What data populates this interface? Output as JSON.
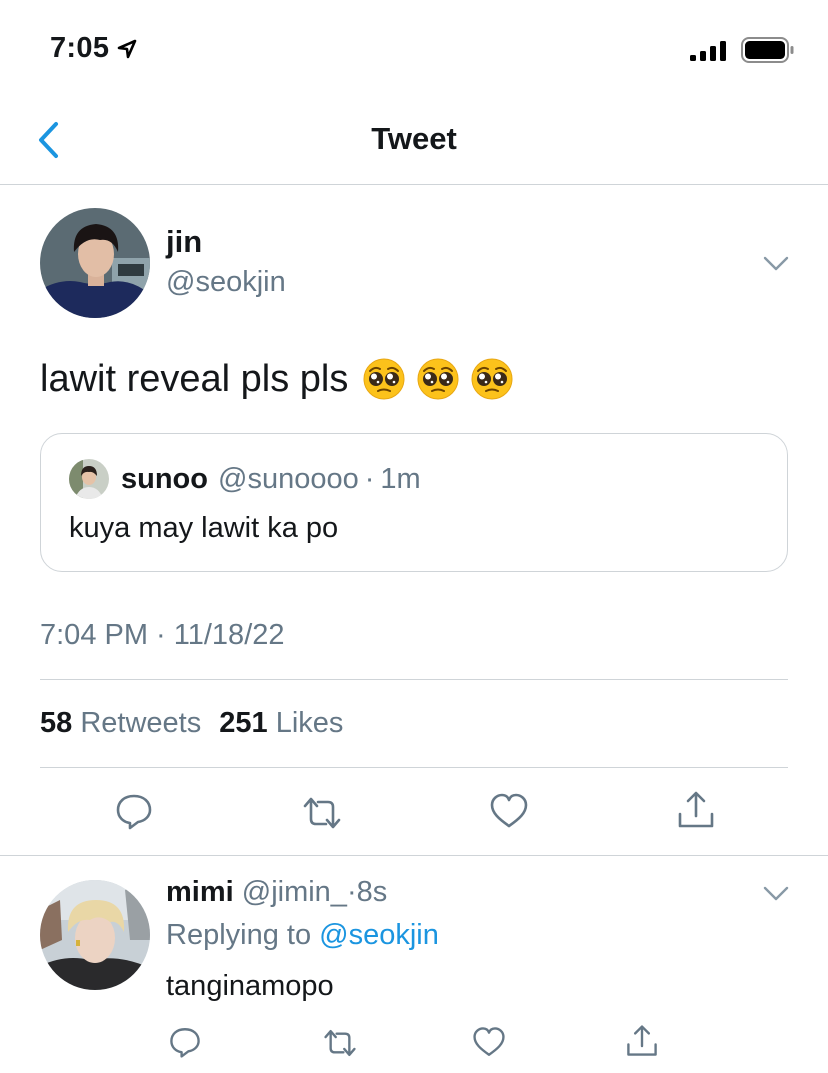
{
  "status_bar": {
    "time": "7:05"
  },
  "nav": {
    "title": "Tweet"
  },
  "tweet": {
    "author_name": "jin",
    "author_handle": "@seokjin",
    "text": "lawit reveal pls pls",
    "emojis": [
      "pleading-face",
      "pleading-face",
      "pleading-face"
    ],
    "quote": {
      "name": "sunoo",
      "handle": "@sunoooo",
      "separator": "·",
      "time": "1m",
      "text": "kuya may lawit ka po"
    },
    "timestamp": "7:04 PM · 11/18/22",
    "retweet_count": "58",
    "retweet_label": "Retweets",
    "like_count": "251",
    "like_label": "Likes",
    "actions": [
      "reply-icon",
      "retweet-icon",
      "like-icon",
      "share-icon"
    ]
  },
  "reply": {
    "name": "mimi",
    "handle": "@jimin_",
    "separator": "·",
    "time": "8s",
    "replying_prefix": "Replying to",
    "replying_to": "@seokjin",
    "text": "tanginamopo"
  },
  "colors": {
    "accent": "#1b95e0",
    "secondary_text": "#657786",
    "divider": "#cfd4d8",
    "text": "#14171a"
  }
}
